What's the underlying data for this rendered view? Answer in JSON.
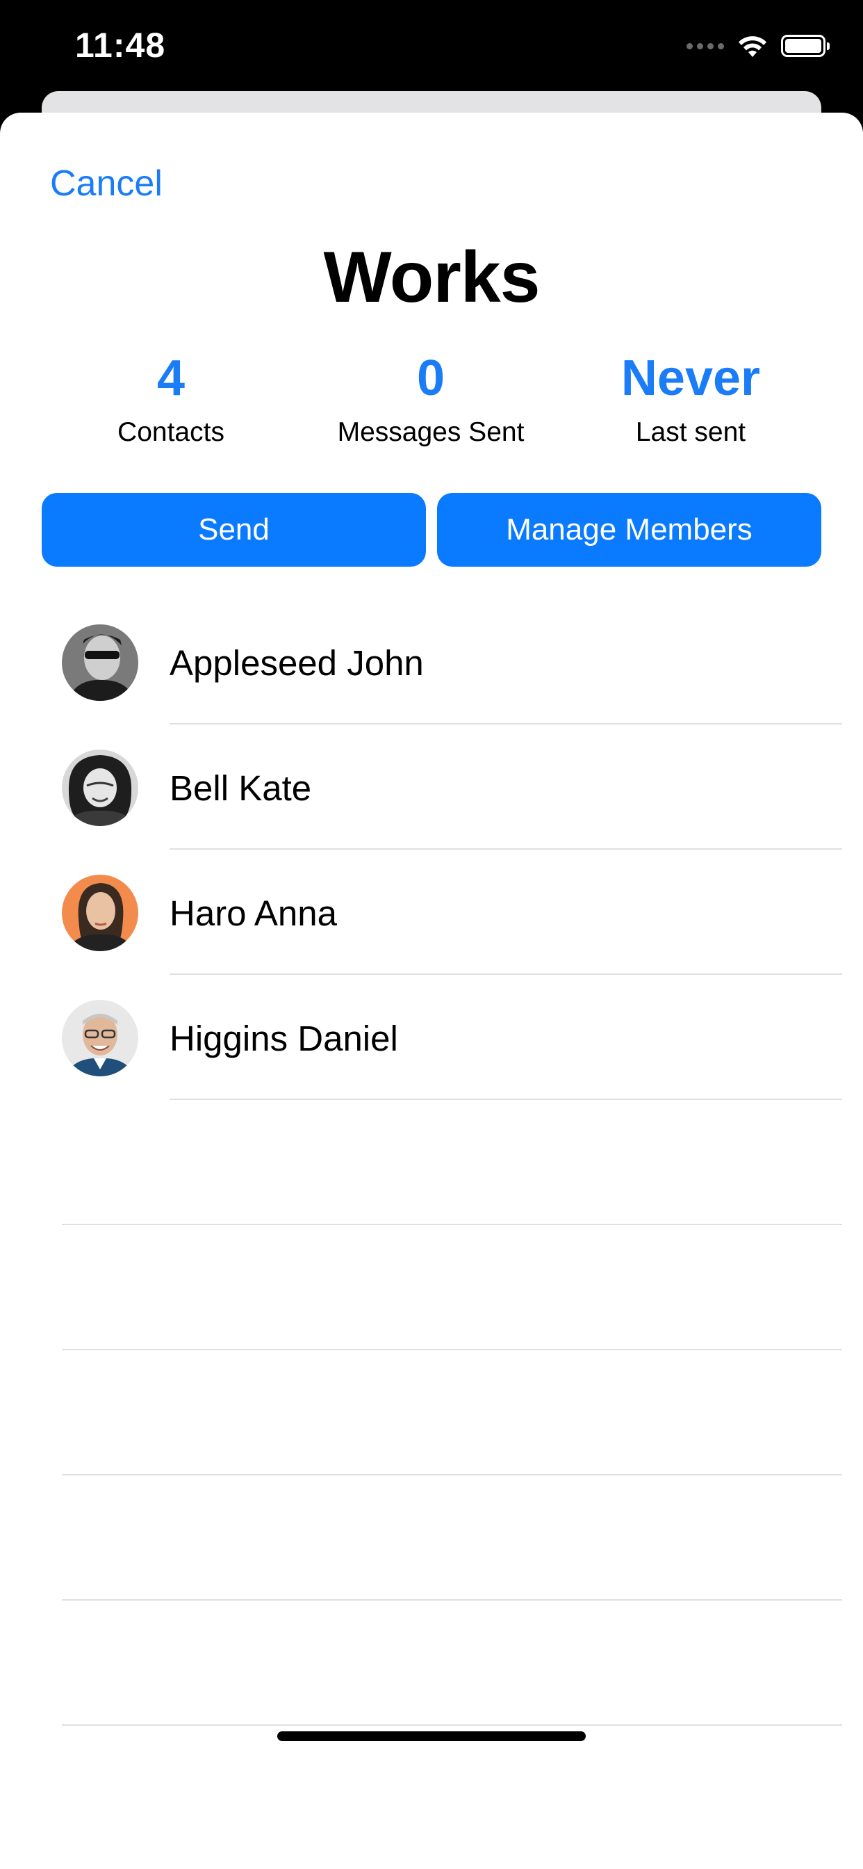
{
  "status_bar": {
    "time": "11:48",
    "icons": [
      "signal-dots-icon",
      "wifi-icon",
      "battery-icon"
    ]
  },
  "header": {
    "cancel_label": "Cancel",
    "title": "Works"
  },
  "stats": [
    {
      "value": "4",
      "label": "Contacts"
    },
    {
      "value": "0",
      "label": "Messages Sent"
    },
    {
      "value": "Never",
      "label": "Last sent"
    }
  ],
  "actions": {
    "send_label": "Send",
    "manage_label": "Manage Members"
  },
  "members": [
    {
      "name": "Appleseed John",
      "avatar": "photo-avatar"
    },
    {
      "name": "Bell Kate",
      "avatar": "photo-avatar"
    },
    {
      "name": "Haro Anna",
      "avatar": "photo-avatar"
    },
    {
      "name": "Higgins Daniel",
      "avatar": "photo-avatar"
    }
  ],
  "colors": {
    "accent": "#1a7cf6",
    "button": "#0a7aff",
    "separator": "#e0e0e2"
  }
}
